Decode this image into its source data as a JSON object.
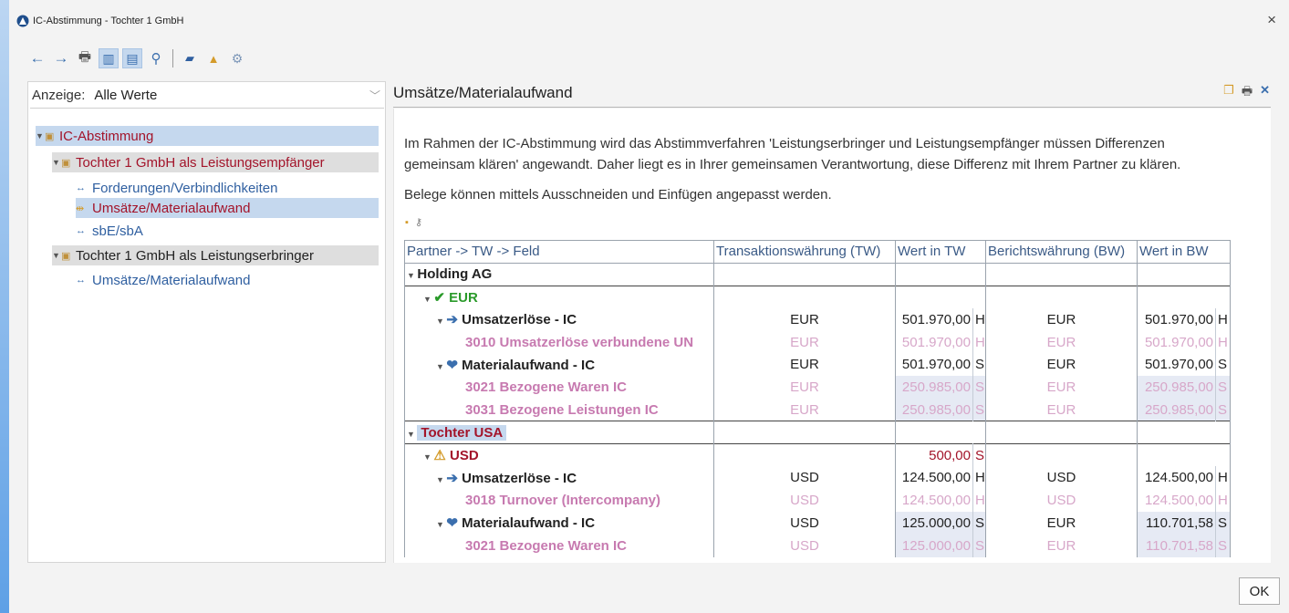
{
  "window": {
    "title": "IC-Abstimmung - Tochter 1 GmbH",
    "close": "×"
  },
  "toolbar": {
    "back": "←",
    "forward": "→",
    "print": "🖶",
    "view1": "▥",
    "view2": "▤",
    "search": "⚲",
    "open": "▰",
    "export": "▲",
    "settings": "⚙"
  },
  "left": {
    "anzeige_label": "Anzeige:",
    "anzeige_value": "Alle Werte",
    "tree": [
      {
        "label": "IC-Abstimmung"
      },
      {
        "label": "Tochter 1 GmbH als Leistungsempfänger"
      },
      {
        "label": "Forderungen/Verbindlichkeiten"
      },
      {
        "label": "Umsätze/Materialaufwand"
      },
      {
        "label": "sbE/sbA"
      },
      {
        "label": "Tochter 1 GmbH als Leistungserbringer"
      },
      {
        "label": "Umsätze/Materialaufwand"
      }
    ]
  },
  "main": {
    "title": "Umsätze/Materialaufwand",
    "para1_line1": "Im Rahmen der IC-Abstimmung wird das Abstimmverfahren 'Leistungserbringer und Leistungsempfänger müssen Differenzen",
    "para1_line2": "gemeinsam klären' angewandt. Daher liegt es in Ihrer gemeinsamen Verantwortung, diese Differenz mit Ihrem Partner zu klären.",
    "para2": "Belege können mittels Ausschneiden und Einfügen angepasst werden.",
    "columns": [
      "Partner -> TW -> Feld",
      "Transaktionswährung (TW)",
      "Wert in TW",
      "Berichtswährung (BW)",
      "Wert in BW"
    ],
    "rows": [
      {
        "label": "Holding AG"
      },
      {
        "label": "EUR"
      },
      {
        "label": "Umsatzerlöse - IC",
        "tw": "EUR",
        "wtw": "501.970,00",
        "f1": "H",
        "bw": "EUR",
        "wbw": "501.970,00",
        "f2": "H"
      },
      {
        "label": "3010 Umsatzerlöse verbundene UN",
        "tw": "EUR",
        "wtw": "501.970,00",
        "f1": "H",
        "bw": "EUR",
        "wbw": "501.970,00",
        "f2": "H"
      },
      {
        "label": "Materialaufwand - IC",
        "tw": "EUR",
        "wtw": "501.970,00",
        "f1": "S",
        "bw": "EUR",
        "wbw": "501.970,00",
        "f2": "S"
      },
      {
        "label": "3021 Bezogene Waren IC",
        "tw": "EUR",
        "wtw": "250.985,00",
        "f1": "S",
        "bw": "EUR",
        "wbw": "250.985,00",
        "f2": "S"
      },
      {
        "label": "3031 Bezogene Leistungen IC",
        "tw": "EUR",
        "wtw": "250.985,00",
        "f1": "S",
        "bw": "EUR",
        "wbw": "250.985,00",
        "f2": "S"
      },
      {
        "label": "Tochter USA"
      },
      {
        "label": "USD",
        "wtw": "500,00",
        "f1": "S"
      },
      {
        "label": "Umsatzerlöse - IC",
        "tw": "USD",
        "wtw": "124.500,00",
        "f1": "H",
        "bw": "USD",
        "wbw": "124.500,00",
        "f2": "H"
      },
      {
        "label": "3018 Turnover (Intercompany)",
        "tw": "USD",
        "wtw": "124.500,00",
        "f1": "H",
        "bw": "USD",
        "wbw": "124.500,00",
        "f2": "H"
      },
      {
        "label": "Materialaufwand - IC",
        "tw": "USD",
        "wtw": "125.000,00",
        "f1": "S",
        "bw": "EUR",
        "wbw": "110.701,58",
        "f2": "S"
      },
      {
        "label": "3021 Bezogene Waren IC",
        "tw": "USD",
        "wtw": "125.000,00",
        "f1": "S",
        "bw": "EUR",
        "wbw": "110.701,58",
        "f2": "S"
      }
    ]
  },
  "footer": {
    "ok": "OK"
  },
  "colors": {
    "accent": "#c5d8ee",
    "error": "#a3142a",
    "ok_green": "#2a9a2a",
    "detail_pink": "#c77ab0"
  }
}
